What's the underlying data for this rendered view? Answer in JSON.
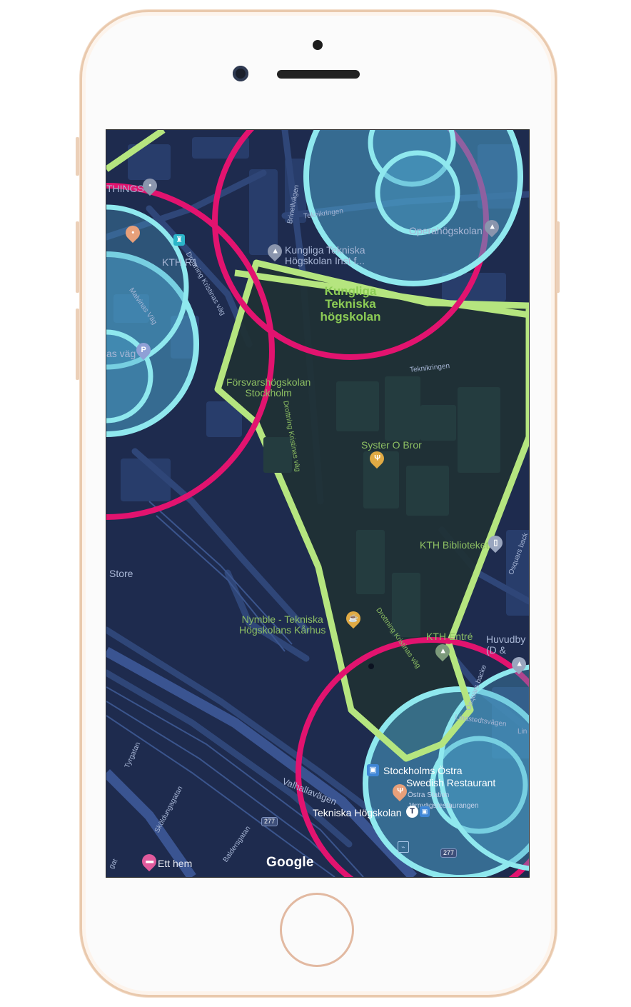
{
  "map": {
    "labels": {
      "things": "THINGS",
      "brinellvagen": "Brinellvägen",
      "teknikringen_top": "Teknikringen",
      "operahogskolan": "Operahögskolan",
      "kth_inst_line1": "Kungliga Tekniska",
      "kth_inst_line2": "Högskolan Inst f...",
      "kth_r1": "KTH R1",
      "drottning_top": "Drottning Kristinas väg",
      "malvinas": "Malvinas Väg",
      "kth_area_line1": "Kungliga",
      "kth_area_line2": "Tekniska",
      "kth_area_line3": "högskolan",
      "malvinas_vag": "as väg",
      "teknikringen_mid": "Teknikringen",
      "forsvars_line1": "Försvarshögskolan",
      "forsvars_line2": "Stockholm",
      "syster_o_bror": "Syster O Bror",
      "drottning_mid": "Drottning Kristinas väg",
      "kth_biblioteket": "KTH Biblioteket",
      "osquars": "Osquars back",
      "store": "Store",
      "nymble_line1": "Nymble - Tekniska",
      "nymble_line2": "Högskolans Kårhus",
      "drottning_low": "Drottning Kristinas väg",
      "kth_entre": "KTH Entré",
      "huvudby_line1": "Huvudby",
      "huvudby_line2": "(D &",
      "osquars_backe": "Osquars backe",
      "lindstedtsvagen": "Lindstedtsvägen",
      "lin": "Lin",
      "tyrgatan": "Tyrgatan",
      "valhallavagen": "Valhallavägen",
      "stockholms_ostra": "Stockholms Östra",
      "swedish_restaurant": "Swedish Restaurant",
      "ostra_station_line1": "Östra Station",
      "ostra_station_line2": "Järnvägsrestaurangen",
      "tekniska_hogskolan": "Tekniska Högskolan",
      "skoldungagatan": "Sköldungagatan",
      "baldersgatan": "Baldersgatan",
      "ett_hem": "Ett hem",
      "gatan_edge": "gat"
    },
    "route_shields": [
      "277",
      "277"
    ],
    "attribution": "Google"
  },
  "icons": [
    "location-pin-icon",
    "castle-icon",
    "graduation-cap-icon",
    "parking-icon",
    "restaurant-icon",
    "cafe-icon",
    "book-icon",
    "train-icon",
    "metro-icon",
    "hotel-icon",
    "bike-icon"
  ],
  "colors": {
    "map_background": "#1e2b4e",
    "campus_fill": "#1f3033",
    "polygon": "#b5e57f",
    "pink_circle": "#e2136f",
    "cyan_circle": "#8fe8ee",
    "cyan_fill": "#4aa0c8"
  }
}
